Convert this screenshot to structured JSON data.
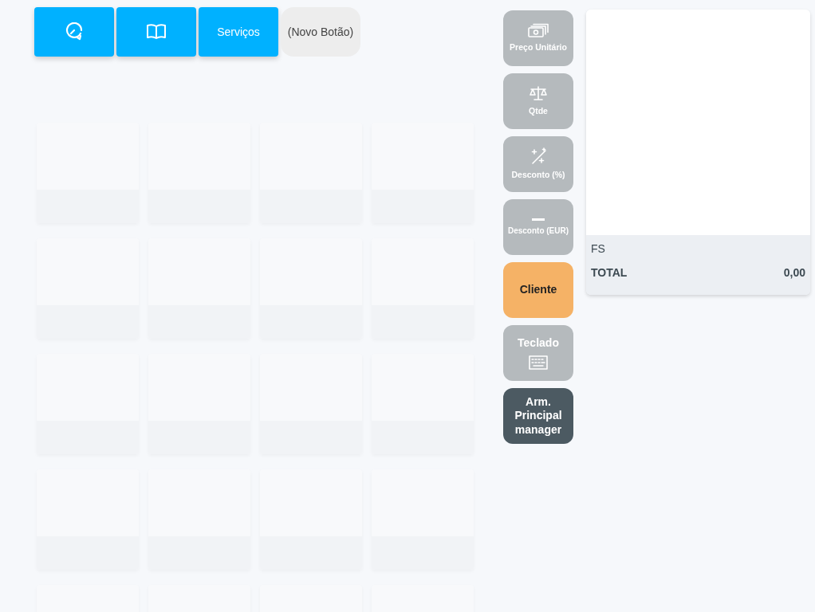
{
  "top_buttons": [
    {
      "kind": "icon"
    },
    {
      "kind": "icon"
    },
    {
      "kind": "text",
      "label": "Serviços"
    },
    {
      "kind": "new",
      "label": "(Novo Botão)"
    }
  ],
  "product_grid": {
    "tiles": [
      {
        "kind": "empty"
      },
      {
        "kind": "empty"
      },
      {
        "kind": "empty"
      },
      {
        "kind": "empty"
      },
      {
        "kind": "empty"
      },
      {
        "kind": "empty"
      },
      {
        "kind": "empty"
      },
      {
        "kind": "empty"
      },
      {
        "kind": "empty"
      },
      {
        "kind": "empty"
      },
      {
        "kind": "empty"
      },
      {
        "kind": "empty"
      },
      {
        "kind": "empty"
      },
      {
        "kind": "empty"
      },
      {
        "kind": "empty"
      },
      {
        "kind": "empty"
      },
      {
        "kind": "empty"
      },
      {
        "kind": "empty"
      },
      {
        "kind": "empty"
      },
      {
        "kind": "empty"
      }
    ]
  },
  "side_buttons": [
    {
      "kind": "tool",
      "label": "Preço Unitário"
    },
    {
      "kind": "tool",
      "label": "Qtde"
    },
    {
      "kind": "tool",
      "label": "Desconto (%)"
    },
    {
      "kind": "tool",
      "label": "Desconto (EUR)"
    },
    {
      "kind": "customer",
      "label": "Cliente"
    },
    {
      "kind": "keyboard",
      "label": "Teclado"
    },
    {
      "kind": "warehouse",
      "label": "Arm. Principal manager"
    }
  ],
  "receipt": {
    "doc_type": "FS",
    "total_label": "TOTAL",
    "total_value": "0,00"
  }
}
